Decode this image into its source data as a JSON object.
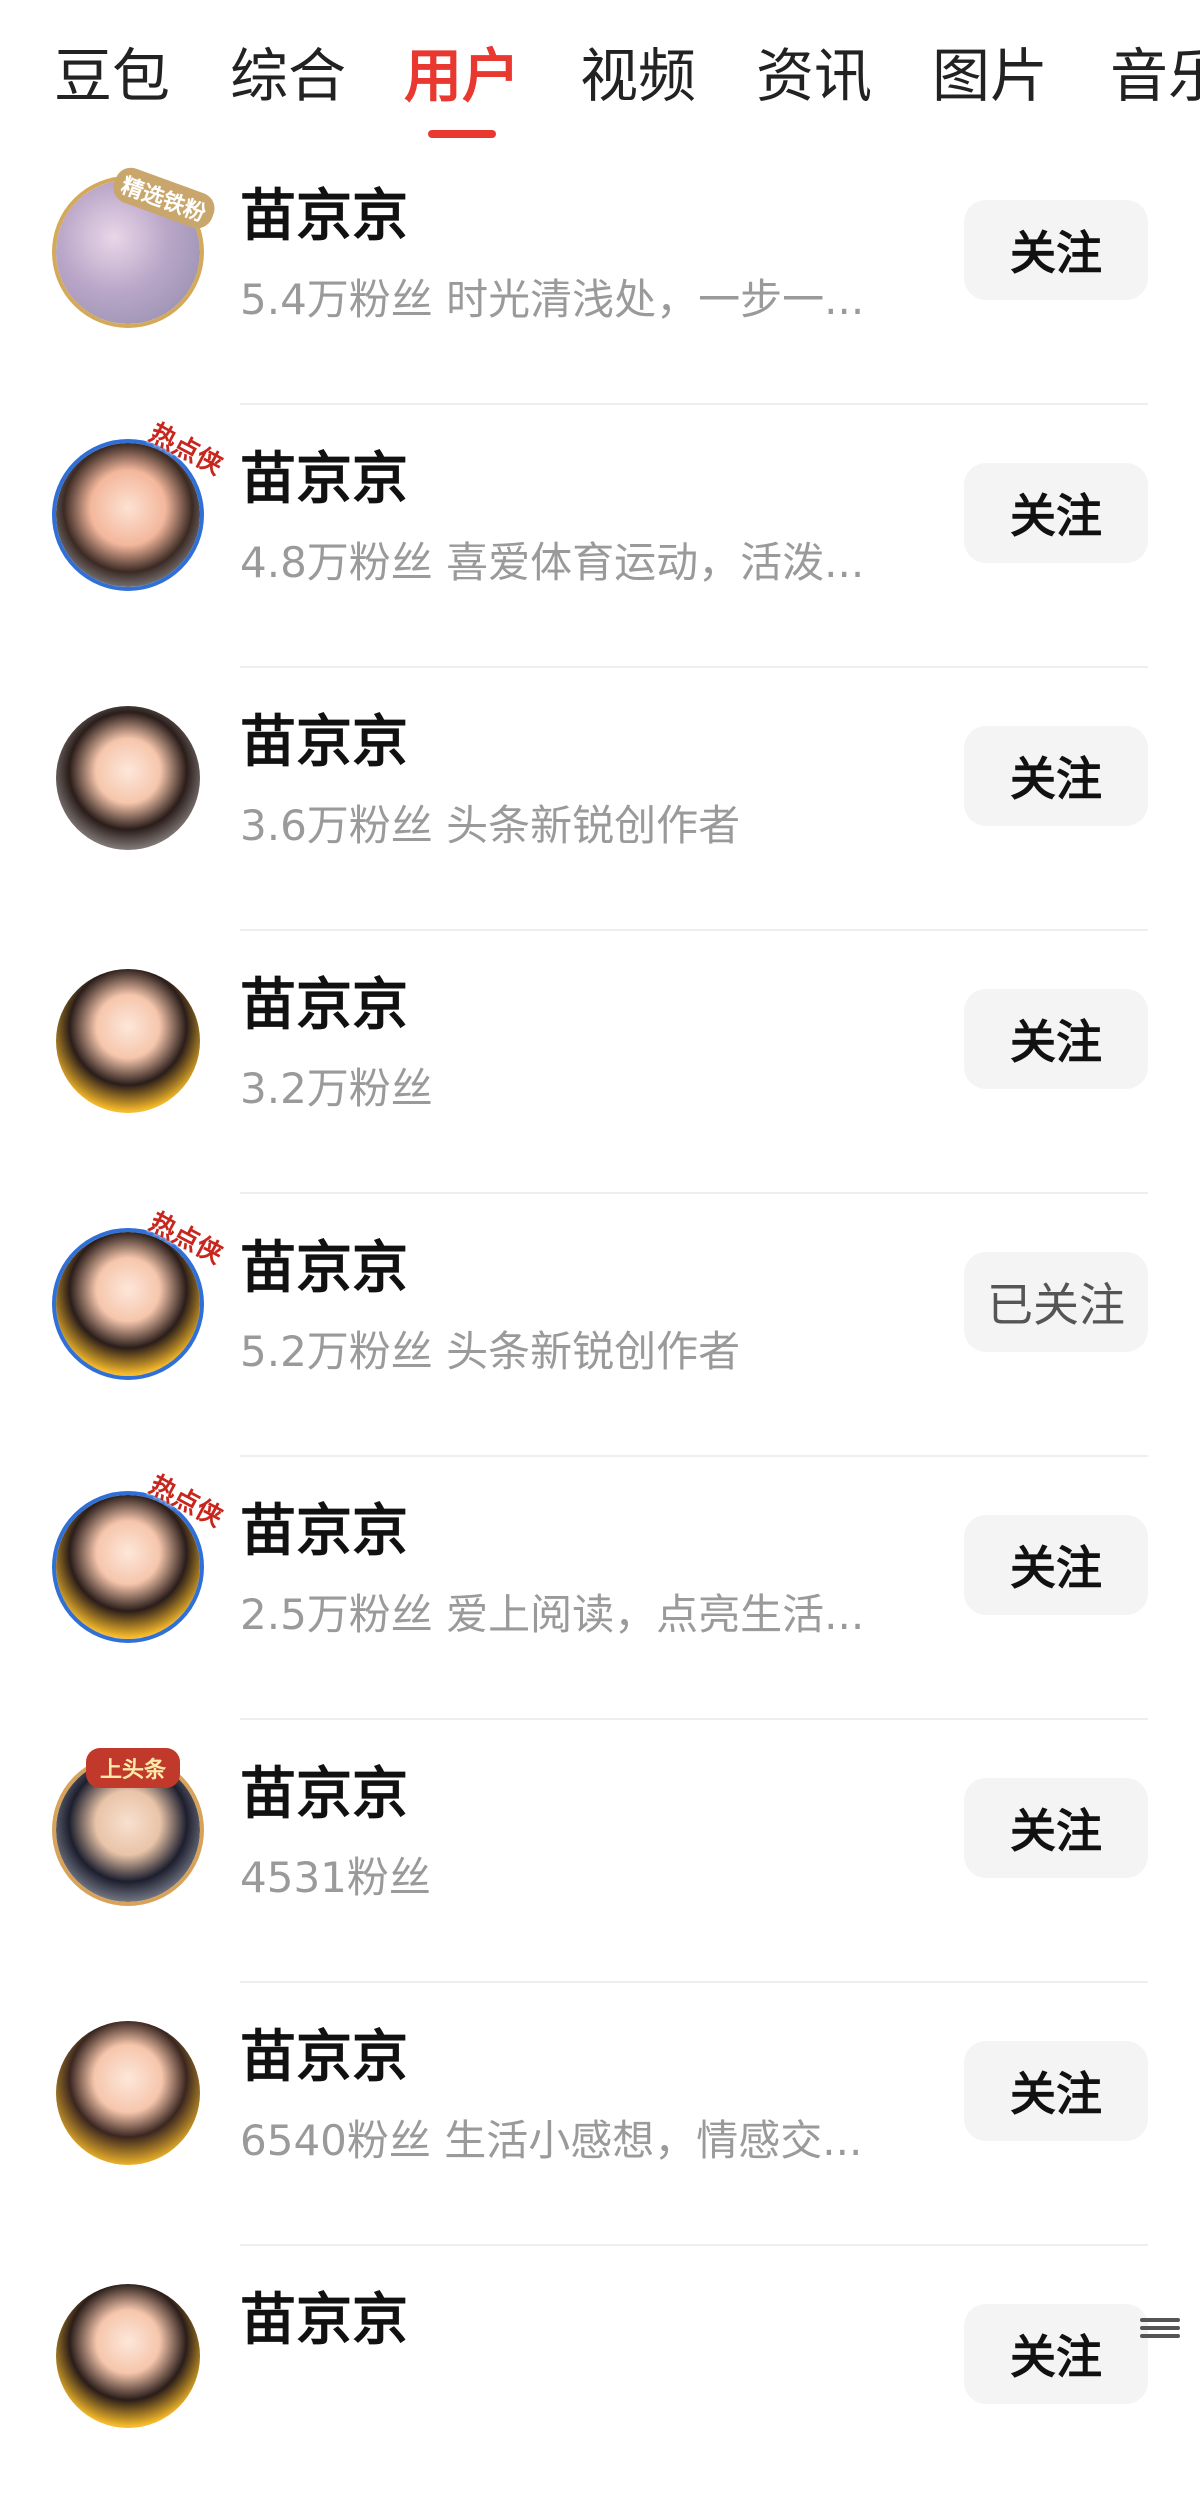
{
  "tabs": [
    {
      "label": "豆包",
      "active": false
    },
    {
      "label": "综合",
      "active": false
    },
    {
      "label": "用户",
      "active": true
    },
    {
      "label": "视频",
      "active": false
    },
    {
      "label": "资讯",
      "active": false
    },
    {
      "label": "图片",
      "active": false
    },
    {
      "label": "音乐",
      "active": false
    }
  ],
  "colors": {
    "accent": "#e8382f",
    "name": "#111111",
    "desc": "#9a9a9a",
    "button_bg": "#f4f4f4"
  },
  "users": [
    {
      "name": "苗京京",
      "desc": "5.4万粉丝 时光清浅处，一步一...",
      "button": "关注",
      "followed": false,
      "badge": "精选铁粉",
      "avatar_style": "magnolia"
    },
    {
      "name": "苗京京",
      "desc": "4.8万粉丝 喜爱体育运动，活泼...",
      "button": "关注",
      "followed": false,
      "badge": "热点侠",
      "avatar_style": "girl-red-blue-ring"
    },
    {
      "name": "苗京京",
      "desc": "3.6万粉丝 头条新锐创作者",
      "button": "关注",
      "followed": false,
      "badge": "",
      "avatar_style": "girl-rose"
    },
    {
      "name": "苗京京",
      "desc": "3.2万粉丝",
      "button": "关注",
      "followed": false,
      "badge": "",
      "avatar_style": "girl-sunflower"
    },
    {
      "name": "苗京京",
      "desc": "5.2万粉丝 头条新锐创作者",
      "button": "已关注",
      "followed": true,
      "badge": "热点侠",
      "avatar_style": "girl-sunflower-blue-ring"
    },
    {
      "name": "苗京京",
      "desc": "2.5万粉丝 爱上阅读，点亮生活...",
      "button": "关注",
      "followed": false,
      "badge": "热点侠",
      "avatar_style": "girl-sunflower-blue-ring"
    },
    {
      "name": "苗京京",
      "desc": "4531粉丝",
      "button": "关注",
      "followed": false,
      "badge": "上头条",
      "avatar_style": "boy"
    },
    {
      "name": "苗京京",
      "desc": "6540粉丝 生活小感想，情感交...",
      "button": "关注",
      "followed": false,
      "badge": "",
      "avatar_style": "girl-sunflower-smile"
    },
    {
      "name": "苗京京",
      "desc": "",
      "button": "关注",
      "followed": false,
      "badge": "",
      "avatar_style": "girl-sunflower"
    }
  ]
}
